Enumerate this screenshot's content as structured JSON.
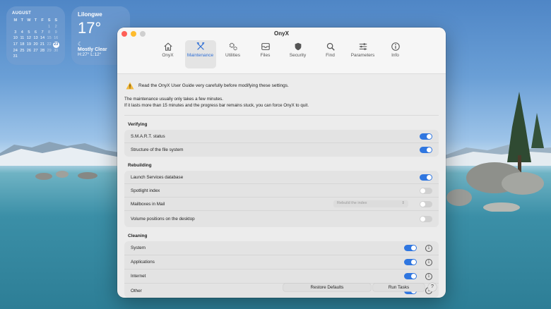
{
  "calendar": {
    "month": "AUGUST",
    "day_headers": [
      "M",
      "T",
      "W",
      "T",
      "F",
      "S",
      "S"
    ],
    "weeks": [
      [
        "",
        "",
        "",
        "",
        "",
        "1",
        "2"
      ],
      [
        "3",
        "4",
        "5",
        "6",
        "7",
        "8",
        "9"
      ],
      [
        "10",
        "11",
        "12",
        "13",
        "14",
        "15",
        "16"
      ],
      [
        "17",
        "18",
        "19",
        "20",
        "21",
        "22",
        "23"
      ],
      [
        "24",
        "25",
        "26",
        "27",
        "28",
        "29",
        "30"
      ],
      [
        "31",
        "",
        "",
        "",
        "",
        "",
        ""
      ]
    ],
    "today": "23"
  },
  "weather": {
    "city": "Lilongwe",
    "temp": "17°",
    "condition": "Mostly Clear",
    "hilo": "H:27° L:12°"
  },
  "window": {
    "title": "OnyX",
    "toolbar": [
      {
        "label": "OnyX",
        "icon": "home-icon"
      },
      {
        "label": "Maintenance",
        "icon": "tools-icon",
        "active": true
      },
      {
        "label": "Utilities",
        "icon": "gears-icon"
      },
      {
        "label": "Files",
        "icon": "drawer-icon"
      },
      {
        "label": "Security",
        "icon": "shield-icon"
      },
      {
        "label": "Find",
        "icon": "search-icon"
      },
      {
        "label": "Parameters",
        "icon": "sliders-icon"
      },
      {
        "label": "Info",
        "icon": "info-icon"
      }
    ],
    "warning": "Read the OnyX User Guide very carefully before modifying these settings.",
    "info_line1": "The maintenance usually only takes a few minutes.",
    "info_line2": "If it lasts more than 15 minutes and the progress bar remains stuck, you can force OnyX to quit.",
    "verifying": {
      "title": "Verifying",
      "items": [
        {
          "label": "S.M.A.R.T. status",
          "on": true
        },
        {
          "label": "Structure of the file system",
          "on": true
        }
      ]
    },
    "rebuilding": {
      "title": "Rebuilding",
      "items": [
        {
          "label": "Launch Services database",
          "on": true
        },
        {
          "label": "Spotlight index",
          "on": false
        },
        {
          "label": "Mailboxes in Mail",
          "on": false,
          "select": "Rebuild the index"
        },
        {
          "label": "Volume positions on the desktop",
          "on": false
        }
      ]
    },
    "cleaning": {
      "title": "Cleaning",
      "items": [
        {
          "label": "System",
          "on": true
        },
        {
          "label": "Applications",
          "on": true
        },
        {
          "label": "Internet",
          "on": true
        },
        {
          "label": "Other",
          "on": true
        }
      ]
    },
    "restore_label": "Restore Defaults",
    "run_label": "Run Tasks",
    "help_label": "?"
  },
  "colors": {
    "accent": "#2f76e0",
    "close": "#fe5f57",
    "minimize": "#febc2e",
    "zoom": "#cfcfcf"
  }
}
